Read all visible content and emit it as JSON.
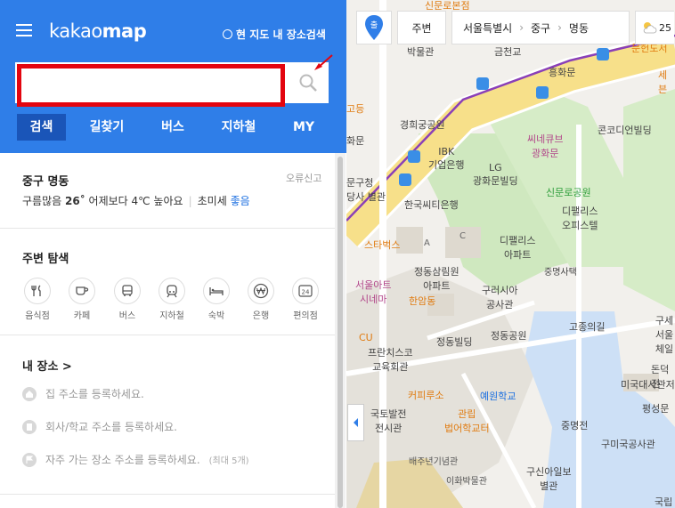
{
  "brand": {
    "text1": "kakao",
    "text2": "map"
  },
  "header": {
    "map_search_label": "현 지도 내 장소검색",
    "search_placeholder": ""
  },
  "tabs": [
    {
      "label": "검색",
      "active": true
    },
    {
      "label": "길찾기"
    },
    {
      "label": "버스"
    },
    {
      "label": "지하철"
    },
    {
      "label": "MY"
    }
  ],
  "location": {
    "title": "중구 명동",
    "report": "오류신고",
    "weather_prefix": "구름많음",
    "temp": "26˚",
    "compare": "어제보다 4℃ 높아요",
    "dust_label": "초미세",
    "dust_value": "좋음"
  },
  "nearby": {
    "title": "주변 탐색",
    "items": [
      {
        "label": "음식점",
        "icon": "fork-knife-icon"
      },
      {
        "label": "카페",
        "icon": "cup-icon"
      },
      {
        "label": "버스",
        "icon": "bus-icon"
      },
      {
        "label": "지하철",
        "icon": "subway-icon"
      },
      {
        "label": "숙박",
        "icon": "bed-icon"
      },
      {
        "label": "은행",
        "icon": "won-icon"
      },
      {
        "label": "편의점",
        "icon": "24-icon"
      }
    ]
  },
  "my_places": {
    "title": "내 장소 >",
    "items": [
      {
        "text": "집 주소를 등록하세요.",
        "extra": ""
      },
      {
        "text": "회사/학교 주소를 등록하세요.",
        "extra": ""
      },
      {
        "text": "자주 가는 장소 주소를 등록하세요.",
        "extra": "(최대 5개)"
      }
    ]
  },
  "map": {
    "nearby_btn": "주변",
    "breadcrumb": [
      "서울특별시",
      "중구",
      "명동"
    ],
    "temp_partial": "25",
    "labels": [
      "신문로본점",
      "박물관",
      "금천교",
      "흥화문",
      "문헌도서",
      "세븐",
      "고등",
      "경희궁공원",
      "콘코디언빌딩",
      "화문",
      "씨네큐브",
      "광화문",
      "IBK",
      "기업은행",
      "LG",
      "광화문빌딩",
      "문구청",
      "당사 별관",
      "신문로공원",
      "한국씨티은행",
      "디팰리스",
      "오피스텔",
      "스타벅스",
      "A",
      "C",
      "디팰리스",
      "아파트",
      "중명사택",
      "서울아트",
      "시네마",
      "정동삼림원",
      "아파트",
      "구러시아",
      "공사관",
      "한암동",
      "고종의길",
      "구세",
      "서울체일",
      "CU",
      "정동빌딩",
      "정동공원",
      "프란치스코",
      "교육회관",
      "돈덕전",
      "미국대사관저",
      "커피루소",
      "예원학교",
      "평성문",
      "국토발전",
      "전시관",
      "관립",
      "법어학교터",
      "중명전",
      "구미국공사관",
      "배주년기념관",
      "이화박물관",
      "구신아일보",
      "별관",
      "국립"
    ]
  },
  "colors": {
    "brand_blue": "#2f7ee8",
    "tab_active": "#1a55b8",
    "highlight_red": "#e3050f",
    "green_label": "#2d9d3a",
    "orange_label": "#e07b10"
  }
}
